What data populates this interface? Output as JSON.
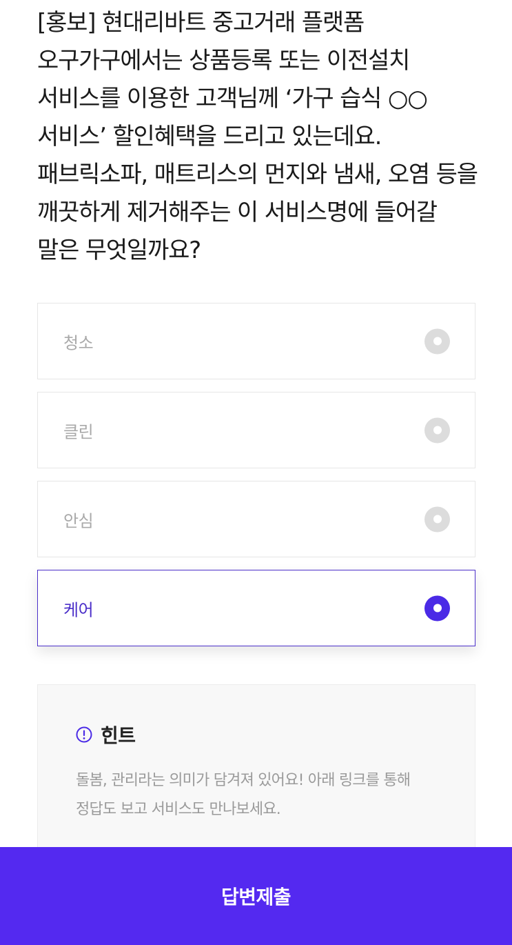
{
  "question": {
    "text": "[홍보] 현대리바트 중고거래 플랫폼 오구가구에서는 상품등록 또는 이전설치 서비스를 이용한 고객님께 ‘가구 습식 ○○서비스’ 할인혜택을 드리고 있는데요. 패브릭소파, 매트리스의 먼지와 냄새, 오염 등을 깨끗하게 제거해주는 이 서비스명에 들어갈 말은 무엇일까요?"
  },
  "options": [
    {
      "label": "청소",
      "selected": false
    },
    {
      "label": "클린",
      "selected": false
    },
    {
      "label": "안심",
      "selected": false
    },
    {
      "label": "케어",
      "selected": true
    }
  ],
  "hint": {
    "title": "힌트",
    "icon": "exclamation-circle-icon",
    "text": "돌봄, 관리라는 의미가 담겨져 있어요! 아래 링크를 통해 정답도 보고 서비스도 만나보세요."
  },
  "submit": {
    "label": "답변제출"
  },
  "colors": {
    "accent": "#5429f0",
    "selected_border": "#4b2fc9",
    "radio_unselected": "#dcdcdc",
    "option_text": "#a9a9a9",
    "hint_background": "#f8f8f8"
  }
}
